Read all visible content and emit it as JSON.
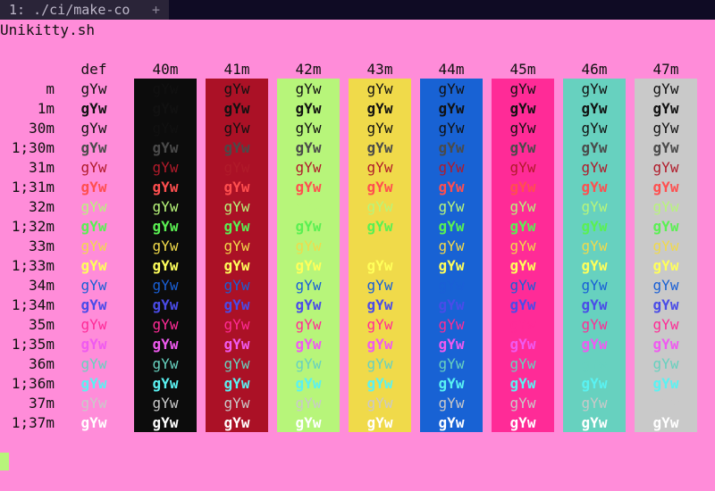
{
  "tab": {
    "label": "1: ./ci/make-co",
    "plus": "+"
  },
  "title": "Unikitty.sh",
  "headers": [
    "def",
    "40m",
    "41m",
    "42m",
    "43m",
    "44m",
    "45m",
    "46m",
    "47m"
  ],
  "backgrounds": [
    "",
    "#0c0c0c",
    "#ab1126",
    "#b7f57a",
    "#f0da4a",
    "#1862d4",
    "#ff2b97",
    "#67d1bf",
    "#c9c9c9"
  ],
  "sample": "gYw",
  "rows": [
    {
      "label": "m",
      "bold": false,
      "fg": "#111111"
    },
    {
      "label": "1m",
      "bold": true,
      "fg": "#111111"
    },
    {
      "label": "30m",
      "bold": false,
      "fg": "#111111"
    },
    {
      "label": "1;30m",
      "bold": true,
      "fg": "#4a4a4a"
    },
    {
      "label": "31m",
      "bold": false,
      "fg": "#b01b2a"
    },
    {
      "label": "1;31m",
      "bold": true,
      "fg": "#ff4f4f"
    },
    {
      "label": "32m",
      "bold": false,
      "fg": "#b7f57a"
    },
    {
      "label": "1;32m",
      "bold": true,
      "fg": "#5af052"
    },
    {
      "label": "33m",
      "bold": false,
      "fg": "#f0da4a"
    },
    {
      "label": "1;33m",
      "bold": true,
      "fg": "#ffff5a"
    },
    {
      "label": "34m",
      "bold": false,
      "fg": "#1a5fd6"
    },
    {
      "label": "1;34m",
      "bold": true,
      "fg": "#4a4ce8"
    },
    {
      "label": "35m",
      "bold": false,
      "fg": "#ff2b97"
    },
    {
      "label": "1;35m",
      "bold": true,
      "fg": "#f05af0"
    },
    {
      "label": "36m",
      "bold": false,
      "fg": "#67d1bf"
    },
    {
      "label": "1;36m",
      "bold": true,
      "fg": "#5af2f2"
    },
    {
      "label": "37m",
      "bold": false,
      "fg": "#c9c9c9"
    },
    {
      "label": "1;37m",
      "bold": true,
      "fg": "#ffffff"
    }
  ]
}
